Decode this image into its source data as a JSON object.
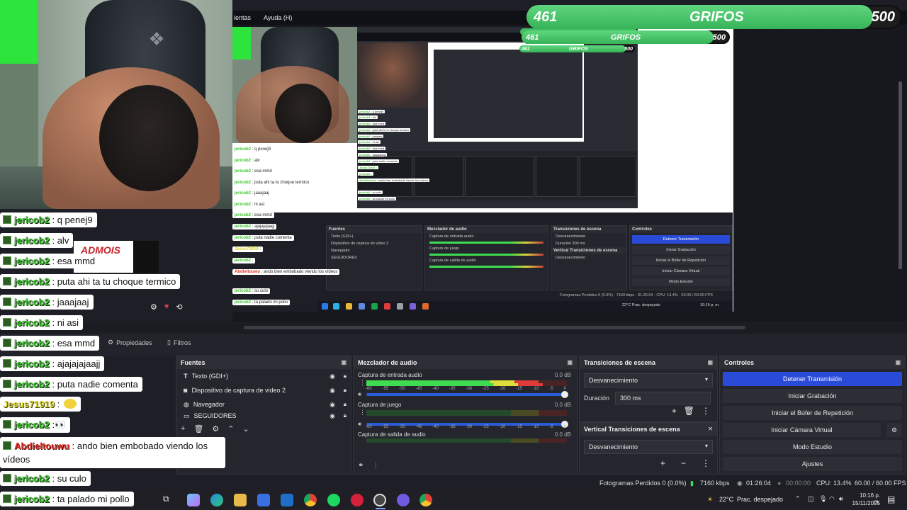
{
  "menubar": {
    "items": [
      "ientas",
      "Ayuda (H)"
    ]
  },
  "goal": {
    "current": "461",
    "label": "GRIFOS",
    "max": "500",
    "fill_fraction": 0.922
  },
  "tabs": {
    "properties": "Propiedades",
    "filters": "Filtros"
  },
  "sources": {
    "title": "Fuentes",
    "items": [
      "Texto (GDI+)",
      "Dispositivo de captura de video 2",
      "Navegador",
      "SEGUIDORES"
    ]
  },
  "mixer": {
    "title": "Mezclador de audio",
    "channels": [
      {
        "name": "Captura de entrada audio",
        "db": "0.0 dB"
      },
      {
        "name": "Captura de juego",
        "db": "0.0 dB"
      },
      {
        "name": "Captura de salida de audio",
        "db": "0.0 dB"
      }
    ],
    "scale": [
      "-60",
      "-55",
      "-50",
      "-45",
      "-40",
      "-35",
      "-30",
      "-25",
      "-20",
      "-15",
      "-10",
      "-5",
      "0"
    ]
  },
  "transitions": {
    "title": "Transiciones de escena",
    "selected": "Desvanecimiento",
    "duration_label": "Duración",
    "duration_value": "300 ms"
  },
  "vertical_transitions": {
    "title": "Vertical Transiciones de escena",
    "selected": "Desvanecimiento"
  },
  "controls": {
    "title": "Controles",
    "stop_stream": "Detener Transmisión",
    "start_recording": "Iniciar Grabación",
    "start_replay": "Iniciar el Búfer de Repetición",
    "virtual_cam": "Iniciar Cámara Virtual",
    "studio_mode": "Modo Estudio",
    "settings": "Ajustes"
  },
  "statusbar": {
    "dropped": "Fotogramas Perdidos 0 (0.0%)",
    "kbps": "7160 kbps",
    "live_time": "01:26:04",
    "rec_time": "00:00:00",
    "cpu": "CPU: 13.4%",
    "fps": "60.00 / 60.00 FPS"
  },
  "taskbar": {
    "weather_temp": "22°C",
    "weather_text": "Prac. despejado",
    "time": "10:16 p. m.",
    "date": "15/11/2025"
  },
  "chat": [
    {
      "user": "jericob2",
      "text": ": q penej9",
      "color": "green"
    },
    {
      "user": "jericob2",
      "text": ": alv",
      "color": "green"
    },
    {
      "user": "jericob2",
      "text": ": esa mmd",
      "color": "green"
    },
    {
      "user": "jericob2",
      "text": ": puta ahi ta tu choque termico",
      "color": "green"
    },
    {
      "user": "jericob2",
      "text": ": jaaajaaj",
      "color": "green"
    },
    {
      "user": "jericob2",
      "text": ": ni asi",
      "color": "green"
    },
    {
      "user": "jericob2",
      "text": ": esa mmd",
      "color": "green"
    },
    {
      "user": "jericob2",
      "text": ": ajajajajaajj",
      "color": "green"
    },
    {
      "user": "jericob2",
      "text": ": puta nadie comenta",
      "color": "green"
    },
    {
      "user": "Jesus71919",
      "text": ":",
      "color": "yellow"
    },
    {
      "user": "jericob2",
      "text": ":",
      "color": "green"
    },
    {
      "user": "Abdieltouwu",
      "text": ": ando bien embobado viendo los vídeos",
      "color": "red"
    },
    {
      "user": "jericob2",
      "text": ": su culo",
      "color": "green"
    },
    {
      "user": "jericob2",
      "text": ": ta palado mi pollo",
      "color": "green"
    }
  ],
  "overlay_text": "ADMOIS",
  "colors": {
    "accent": "#2a4ad8",
    "goal_fill": "#3fbf5f",
    "chat_user": "#3ec42f",
    "chat_user_red": "#e0342a"
  }
}
